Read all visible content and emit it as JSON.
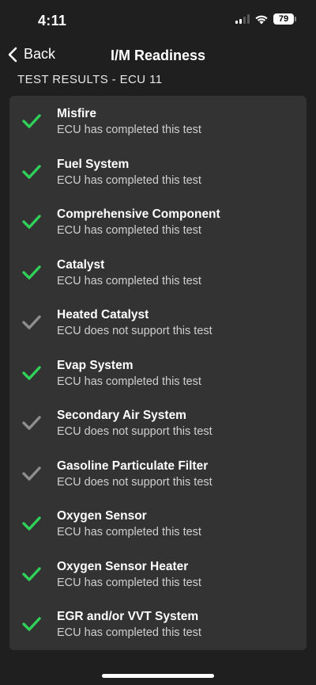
{
  "status_bar": {
    "time": "4:11",
    "battery": "79"
  },
  "nav": {
    "back_label": "Back",
    "title": "I/M Readiness"
  },
  "section_header": "TEST RESULTS - ECU 11",
  "colors": {
    "completed": "#30d158",
    "unsupported": "#8e8e8e"
  },
  "tests": [
    {
      "name": "Misfire",
      "status": "ECU has completed this test",
      "state": "completed"
    },
    {
      "name": "Fuel System",
      "status": "ECU has completed this test",
      "state": "completed"
    },
    {
      "name": "Comprehensive Component",
      "status": "ECU has completed this test",
      "state": "completed"
    },
    {
      "name": "Catalyst",
      "status": "ECU has completed this test",
      "state": "completed"
    },
    {
      "name": "Heated Catalyst",
      "status": "ECU does not support this test",
      "state": "unsupported"
    },
    {
      "name": "Evap System",
      "status": "ECU has completed this test",
      "state": "completed"
    },
    {
      "name": "Secondary Air System",
      "status": "ECU does not support this test",
      "state": "unsupported"
    },
    {
      "name": "Gasoline Particulate Filter",
      "status": "ECU does not support this test",
      "state": "unsupported"
    },
    {
      "name": "Oxygen Sensor",
      "status": "ECU has completed this test",
      "state": "completed"
    },
    {
      "name": "Oxygen Sensor Heater",
      "status": "ECU has completed this test",
      "state": "completed"
    },
    {
      "name": "EGR and/or VVT System",
      "status": "ECU has completed this test",
      "state": "completed"
    }
  ]
}
